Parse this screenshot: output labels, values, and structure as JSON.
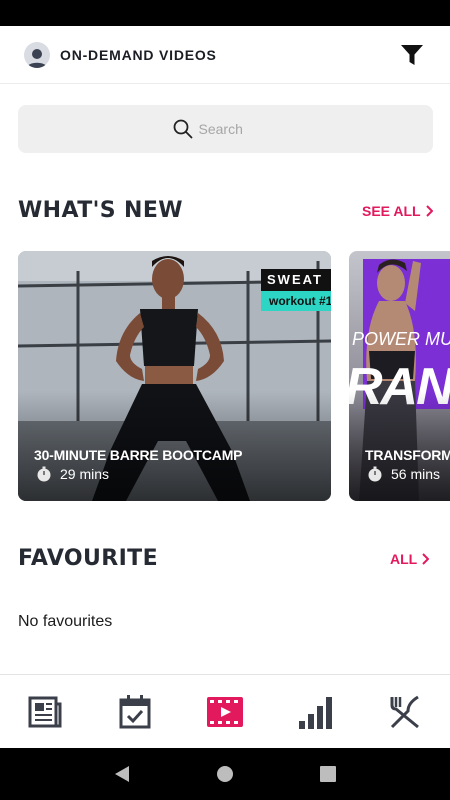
{
  "header": {
    "title": "ON-DEMAND VIDEOS"
  },
  "search": {
    "placeholder": "Search"
  },
  "whats_new": {
    "title": "WHAT'S NEW",
    "see_all_label": "SEE ALL",
    "cards": [
      {
        "title": "30-MINUTE BARRE BOOTCAMP",
        "duration": "29 mins",
        "badge_top": "SWEAT",
        "badge_bottom": "workout #1"
      },
      {
        "title": "TRANSFORM",
        "duration": "56 mins",
        "overlay_line_1": "POWER MUS",
        "overlay_line_2": "RAN"
      }
    ]
  },
  "favourite": {
    "title": "FAVOURITE",
    "all_label": "ALL",
    "empty_text": "No favourites"
  },
  "bottom_nav": {
    "items": [
      "news-icon",
      "calendar-check-icon",
      "video-icon",
      "stats-icon",
      "food-icon"
    ],
    "active_index": 2
  },
  "colors": {
    "accent": "#e2195c",
    "text_dark": "#262a33",
    "badge_teal": "#2cd5c4",
    "card_purple": "#7b2fd4"
  }
}
